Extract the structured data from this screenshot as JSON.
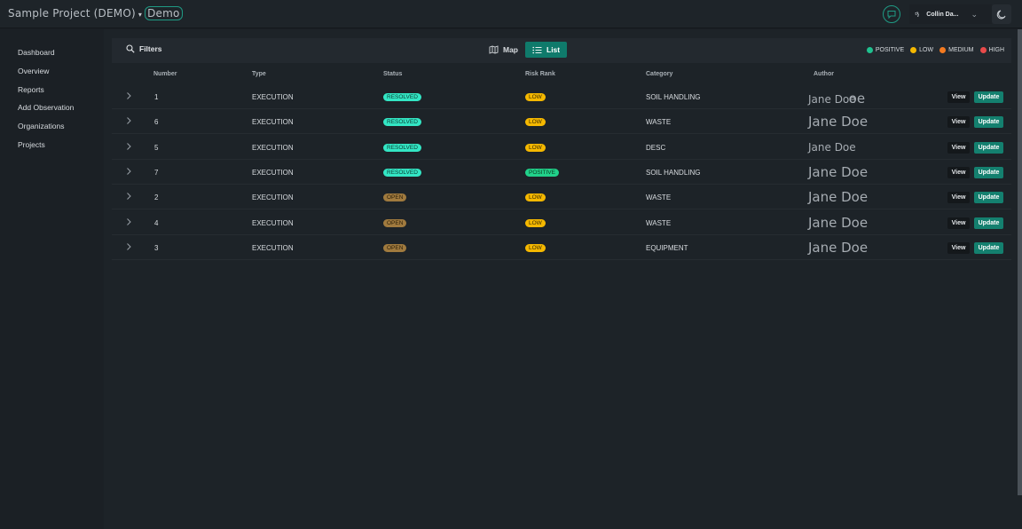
{
  "header": {
    "project_title": "Sample Project (DEMO)",
    "project_caret": "▾",
    "project_chip": "Demo",
    "user_glyph": "ጓ",
    "user_name": "Collin Da...",
    "user_caret": "⌄"
  },
  "sidebar": {
    "items": [
      {
        "label": "Dashboard"
      },
      {
        "label": "Overview"
      },
      {
        "label": "Reports"
      },
      {
        "label": "Add Observation"
      },
      {
        "label": "Organizations"
      },
      {
        "label": "Projects"
      }
    ]
  },
  "toolbar": {
    "filters_label": "Filters",
    "map_label": "Map",
    "list_label": "List"
  },
  "legend": [
    {
      "label": "POSITIVE",
      "color": "#1fc18f"
    },
    {
      "label": "LOW",
      "color": "#f5b800"
    },
    {
      "label": "MEDIUM",
      "color": "#f47a20"
    },
    {
      "label": "HIGH",
      "color": "#e84a4a"
    }
  ],
  "table": {
    "columns": [
      "Number",
      "Type",
      "Status",
      "Risk Rank",
      "Category",
      "Author"
    ],
    "view_label": "View",
    "update_label": "Update",
    "rows": [
      {
        "number": "1",
        "type": "EXECUTION",
        "status": "RESOLVED",
        "risk": "LOW",
        "category": "SOIL HANDLING",
        "author": "Jane Doe",
        "author_echo": "oe"
      },
      {
        "number": "6",
        "type": "EXECUTION",
        "status": "RESOLVED",
        "risk": "LOW",
        "category": "WASTE",
        "author": "Jane Doe"
      },
      {
        "number": "5",
        "type": "EXECUTION",
        "status": "RESOLVED",
        "risk": "LOW",
        "category": "DESC",
        "author": "Jane Doe"
      },
      {
        "number": "7",
        "type": "EXECUTION",
        "status": "RESOLVED",
        "risk": "POSITIVE",
        "category": "SOIL HANDLING",
        "author": "Jane Doe"
      },
      {
        "number": "2",
        "type": "EXECUTION",
        "status": "OPEN",
        "risk": "LOW",
        "category": "WASTE",
        "author": "Jane Doe"
      },
      {
        "number": "4",
        "type": "EXECUTION",
        "status": "OPEN",
        "risk": "LOW",
        "category": "WASTE",
        "author": "Jane Doe"
      },
      {
        "number": "3",
        "type": "EXECUTION",
        "status": "OPEN",
        "risk": "LOW",
        "category": "EQUIPMENT",
        "author": "Jane Doe"
      }
    ]
  },
  "colors": {
    "accent": "#14806f",
    "resolved": "#33e6c4",
    "open": "#a07a3e",
    "low": "#f5b800",
    "positive": "#21d18a"
  }
}
